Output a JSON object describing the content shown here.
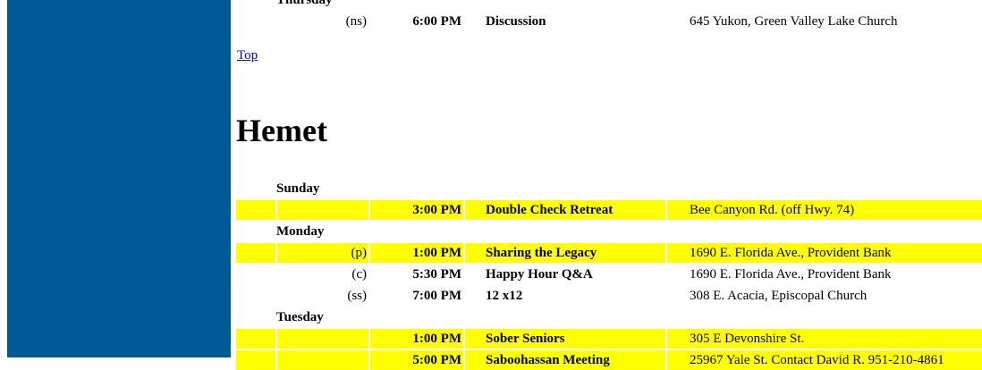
{
  "colors": {
    "sidebar": "#005a96",
    "highlight": "#ffff00",
    "link": "#0000ee"
  },
  "prev_section": {
    "day": "Thursday",
    "meetings": [
      {
        "type": "(ns)",
        "time": "6:00 PM",
        "name": "Discussion",
        "location": "645 Yukon, Green Valley Lake Church",
        "highlight": false
      }
    ]
  },
  "top_link": "Top",
  "section": {
    "city": "Hemet",
    "days": [
      {
        "day": "Sunday",
        "meetings": [
          {
            "type": "",
            "time": "3:00 PM",
            "name": "Double Check Retreat",
            "location": "Bee Canyon Rd. (off Hwy. 74)",
            "highlight": true
          }
        ]
      },
      {
        "day": "Monday",
        "meetings": [
          {
            "type": "(p)",
            "time": "1:00 PM",
            "name": "Sharing the Legacy",
            "location": "1690 E. Florida Ave., Provident Bank",
            "highlight": true
          },
          {
            "type": "(c)",
            "time": "5:30 PM",
            "name": "Happy Hour Q&A",
            "location": "1690 E. Florida Ave., Provident Bank",
            "highlight": false
          },
          {
            "type": "(ss)",
            "time": "7:00 PM",
            "name": "12 x12",
            "location": "308 E. Acacia, Episcopal Church",
            "highlight": false
          }
        ]
      },
      {
        "day": "Tuesday",
        "meetings": [
          {
            "type": "",
            "time": "1:00 PM",
            "name": "Sober Seniors",
            "location": "305 E Devonshire St.",
            "highlight": true
          },
          {
            "type": "",
            "time": "5:00 PM",
            "name": "Saboohassan Meeting",
            "location": "25967 Yale St. Contact David R. 951-210-4861",
            "highlight": true
          }
        ]
      }
    ]
  }
}
